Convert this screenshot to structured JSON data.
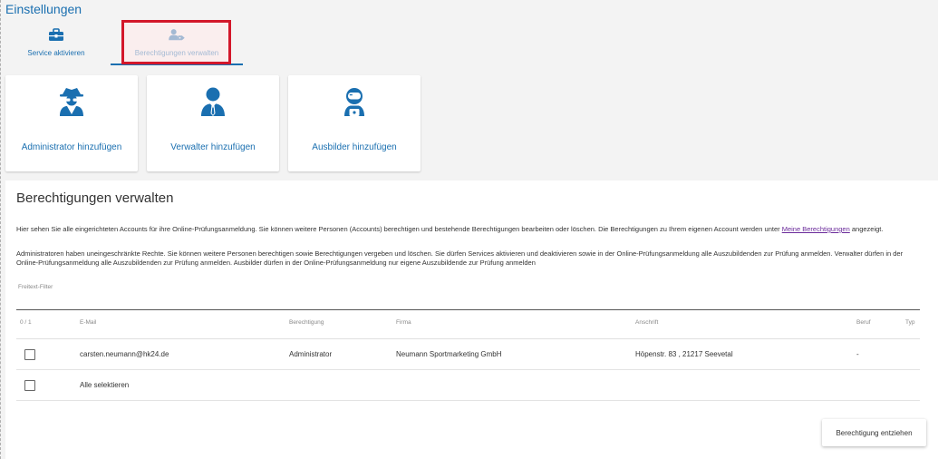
{
  "page": {
    "title": "Einstellungen"
  },
  "tabs": {
    "service": {
      "label": "Service aktivieren",
      "icon": "toolbox-icon"
    },
    "permissions": {
      "label": "Berechtigungen verwalten",
      "icon": "user-tag-icon",
      "active": true
    }
  },
  "cards": [
    {
      "label": "Administrator hinzufügen",
      "icon": "user-secret-icon"
    },
    {
      "label": "Verwalter hinzufügen",
      "icon": "user-tie-icon"
    },
    {
      "label": "Ausbilder hinzufügen",
      "icon": "user-astronaut-icon"
    }
  ],
  "panel": {
    "title": "Berechtigungen verwalten",
    "desc1_text": "Hier sehen Sie alle eingerichteten Accounts für ihre Online-Prüfungsanmeldung. Sie können weitere Personen (Accounts) berechtigen und bestehende Berechtigungen bearbeiten oder löschen. Die Berechtigungen zu Ihrem eigenen Account werden unter ",
    "desc1_link": "Meine Berechtigungen",
    "desc1_tail": " angezeigt.",
    "desc2": "Administratoren haben uneingeschränkte Rechte. Sie können weitere Personen berechtigen sowie Berechtigungen vergeben und löschen. Sie dürfen Services aktivieren und deaktivieren sowie in der Online-Prüfungsanmeldung alle Auszubildenden zur Prüfung anmelden. Verwalter dürfen in der Online-Prüfungsanmeldung alle Auszubildenden zur Prüfung anmelden. Ausbilder dürfen in der Online-Prüfungsanmeldung nur eigene Auszubildende zur Prüfung anmelden",
    "filter_label": "Freitext-Filter"
  },
  "table": {
    "columns": {
      "selection": "0 / 1",
      "email": "E-Mail",
      "permission": "Berechtigung",
      "company": "Firma",
      "address": "Anschrift",
      "profession": "Beruf",
      "type": "Typ"
    },
    "rows": [
      {
        "email": "carsten.neumann@hk24.de",
        "permission": "Administrator",
        "company": "Neumann Sportmarketing GmbH",
        "address": "Höpenstr. 83 , 21217 Seevetal",
        "profession": "-",
        "type": ""
      }
    ],
    "select_all_label": "Alle selektieren"
  },
  "actions": {
    "revoke_label": "Berechtigung entziehen"
  },
  "colors": {
    "accent": "#1a6fb0",
    "highlight": "#d3172a",
    "link": "#6a2a9a"
  }
}
